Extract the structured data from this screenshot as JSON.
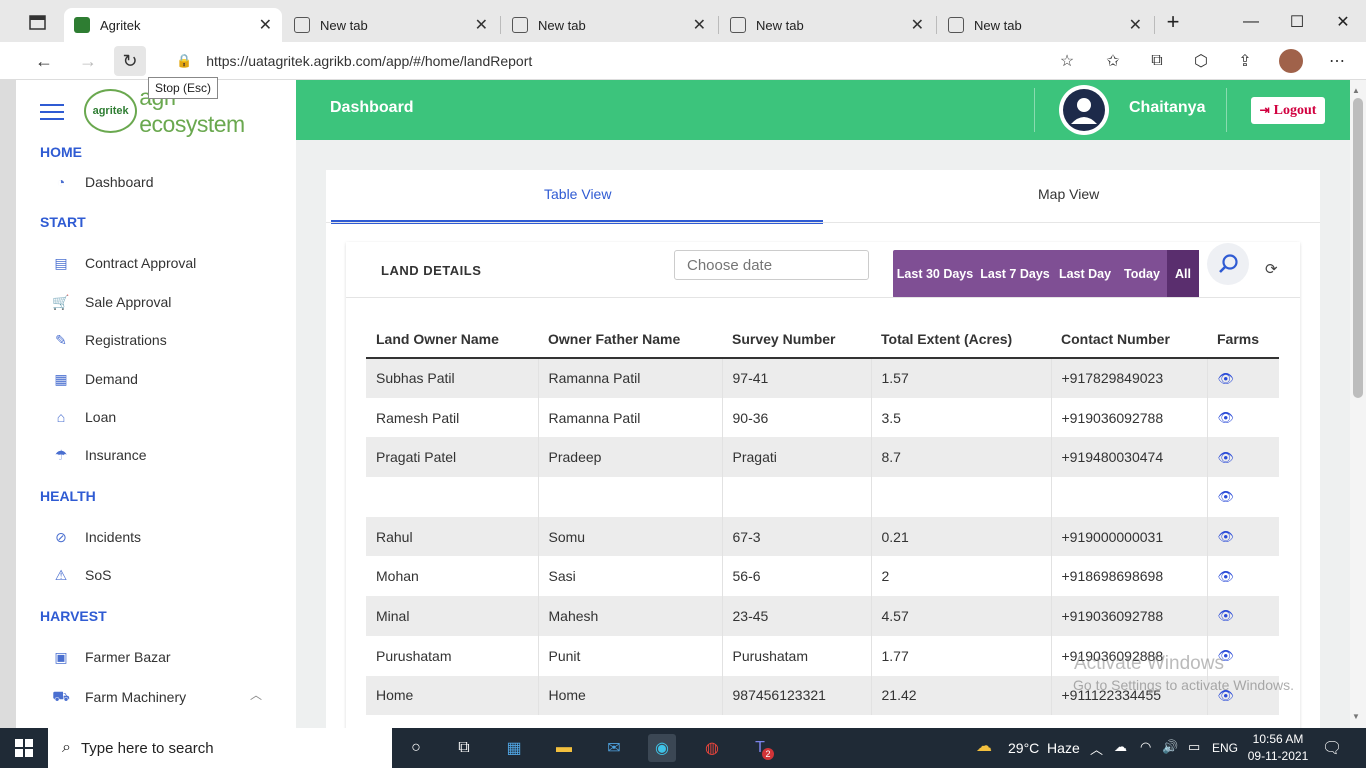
{
  "browser": {
    "tabs": [
      {
        "title": "Agritek",
        "active": true
      },
      {
        "title": "New tab"
      },
      {
        "title": "New tab"
      },
      {
        "title": "New tab"
      },
      {
        "title": "New tab"
      }
    ],
    "url": "https://uatagritek.agrikb.com/app/#/home/landReport",
    "tooltip": "Stop (Esc)"
  },
  "app": {
    "logo_text": "agri ecosystem",
    "logo_brand": "agritek",
    "header_title": "Dashboard",
    "user_name": "Chaitanya",
    "logout_label": "Logout"
  },
  "sidebar": {
    "sections": [
      {
        "label": "HOME",
        "items": [
          {
            "label": "Dashboard",
            "icon": "gauge-icon"
          }
        ]
      },
      {
        "label": "START",
        "items": [
          {
            "label": "Contract Approval",
            "icon": "contract-icon"
          },
          {
            "label": "Sale Approval",
            "icon": "cart-icon"
          },
          {
            "label": "Registrations",
            "icon": "register-icon"
          },
          {
            "label": "Demand",
            "icon": "demand-icon"
          },
          {
            "label": "Loan",
            "icon": "loan-icon"
          },
          {
            "label": "Insurance",
            "icon": "insurance-icon"
          }
        ]
      },
      {
        "label": "HEALTH",
        "items": [
          {
            "label": "Incidents",
            "icon": "incident-icon"
          },
          {
            "label": "SoS",
            "icon": "sos-icon"
          }
        ]
      },
      {
        "label": "HARVEST",
        "items": [
          {
            "label": "Farmer Bazar",
            "icon": "bazar-icon"
          },
          {
            "label": "Farm Machinery",
            "icon": "tractor-icon"
          }
        ]
      }
    ]
  },
  "main": {
    "tabs": [
      {
        "label": "Table View",
        "active": true
      },
      {
        "label": "Map View"
      }
    ],
    "panel_title": "LAND DETAILS",
    "date_placeholder": "Choose date",
    "filters": [
      {
        "label": "Last 30 Days"
      },
      {
        "label": "Last 7 Days"
      },
      {
        "label": "Last Day"
      },
      {
        "label": "Today"
      },
      {
        "label": "All",
        "active": true
      }
    ],
    "table": {
      "columns": [
        "Land Owner Name",
        "Owner Father Name",
        "Survey Number",
        "Total Extent (Acres)",
        "Contact Number",
        "Farms"
      ],
      "rows": [
        [
          "Subhas Patil",
          "Ramanna Patil",
          "97-41",
          "1.57",
          "+917829849023"
        ],
        [
          "Ramesh Patil",
          "Ramanna Patil",
          "90-36",
          "3.5",
          "+919036092788"
        ],
        [
          "Pragati Patel",
          "Pradeep",
          "Pragati",
          "8.7",
          "+919480030474"
        ],
        [
          "",
          "",
          "",
          "",
          ""
        ],
        [
          "Rahul",
          "Somu",
          "67-3",
          "0.21",
          "+919000000031"
        ],
        [
          "Mohan",
          "Sasi",
          "56-6",
          "2",
          "+918698698698"
        ],
        [
          "Minal",
          "Mahesh",
          "23-45",
          "4.57",
          "+919036092788"
        ],
        [
          "Purushatam",
          "Punit",
          "Purushatam",
          "1.77",
          "+919036092888"
        ],
        [
          "Home",
          "Home",
          "987456123321",
          "21.42",
          "+911122334455"
        ]
      ]
    }
  },
  "watermark": {
    "title": "Activate Windows",
    "subtitle": "Go to Settings to activate Windows."
  },
  "taskbar": {
    "search_placeholder": "Type here to search",
    "weather": "29°C  Haze",
    "language": "ENG",
    "time": "10:56 AM",
    "date": "09-11-2021",
    "teams_badge": "2"
  },
  "colors": {
    "header_green": "#3cc47c",
    "accent_blue": "#2f5bd3",
    "filter_purple": "#7f4f94",
    "logout_red": "#d1003f"
  }
}
